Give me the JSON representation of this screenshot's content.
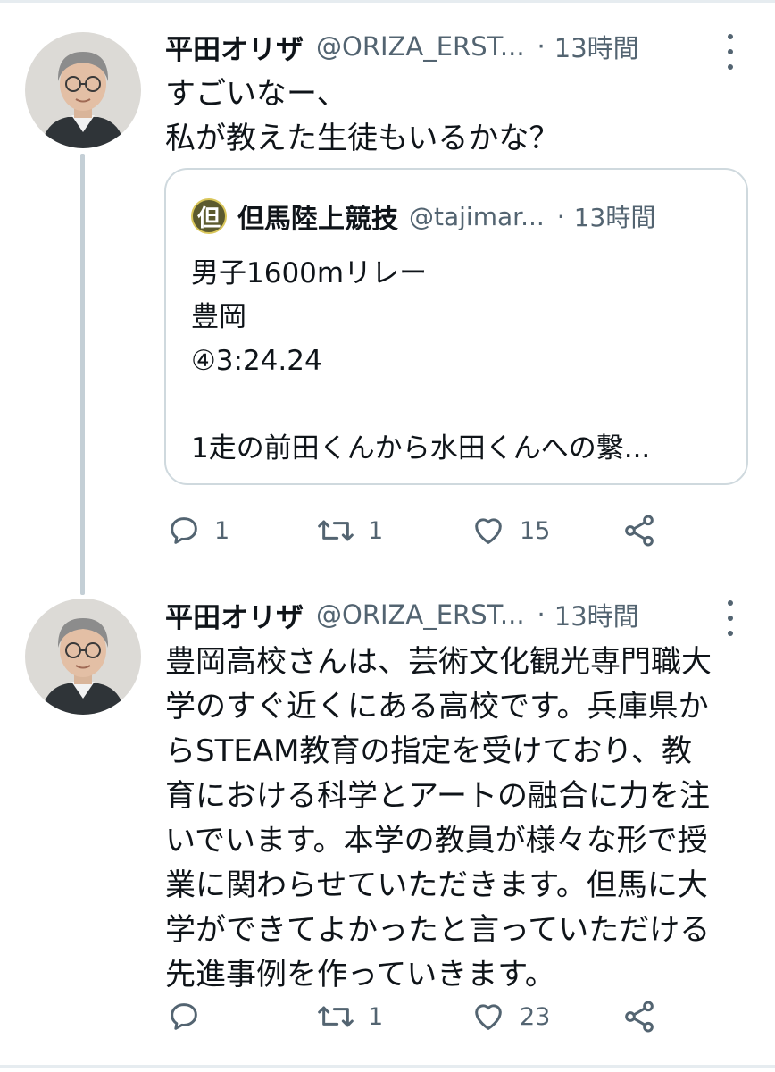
{
  "tweets": [
    {
      "author": {
        "name": "平田オリザ",
        "handle": "@ORIZA_ERST...",
        "avatar": "avatar-person-glasses"
      },
      "time": "13時間",
      "dot": "·",
      "text_lines": [
        "すごいなー、",
        "私が教えた生徒もいるかな？"
      ],
      "quote": {
        "author": {
          "name": "但馬陸上競技",
          "handle": "@tajimar...",
          "avatar_char": "但"
        },
        "time": "13時間",
        "dot": "·",
        "text_lines": [
          "男子1600mリレー",
          "豊岡",
          "④3:24.24",
          "",
          "1走の前田くんから水田くんへの繋..."
        ]
      },
      "actions": {
        "reply_count": "1",
        "retweet_count": "1",
        "like_count": "15"
      }
    },
    {
      "author": {
        "name": "平田オリザ",
        "handle": "@ORIZA_ERST...",
        "avatar": "avatar-person-glasses"
      },
      "time": "13時間",
      "dot": "·",
      "text_lines": [
        "豊岡高校さんは、芸術文化観光専門職大",
        "学のすぐ近くにある高校です。兵庫県か",
        "らSTEAM教育の指定を受けており、教",
        "育における科学とアートの融合に力を注",
        "いでいます。本学の教員が様々な形で授",
        "業に関わらせていただきます。但馬に大",
        "学ができてよかったと言っていただける",
        "先進事例を作っていきます。"
      ],
      "actions": {
        "reply_count": "",
        "retweet_count": "1",
        "like_count": "23"
      }
    }
  ],
  "colors": {
    "text": "#0f1419",
    "muted": "#536471",
    "border": "#cfd9de",
    "thread": "#c4cfd6",
    "background": "#ffffff"
  },
  "icons": [
    "reply-icon",
    "retweet-icon",
    "like-icon",
    "share-icon",
    "more-icon"
  ]
}
